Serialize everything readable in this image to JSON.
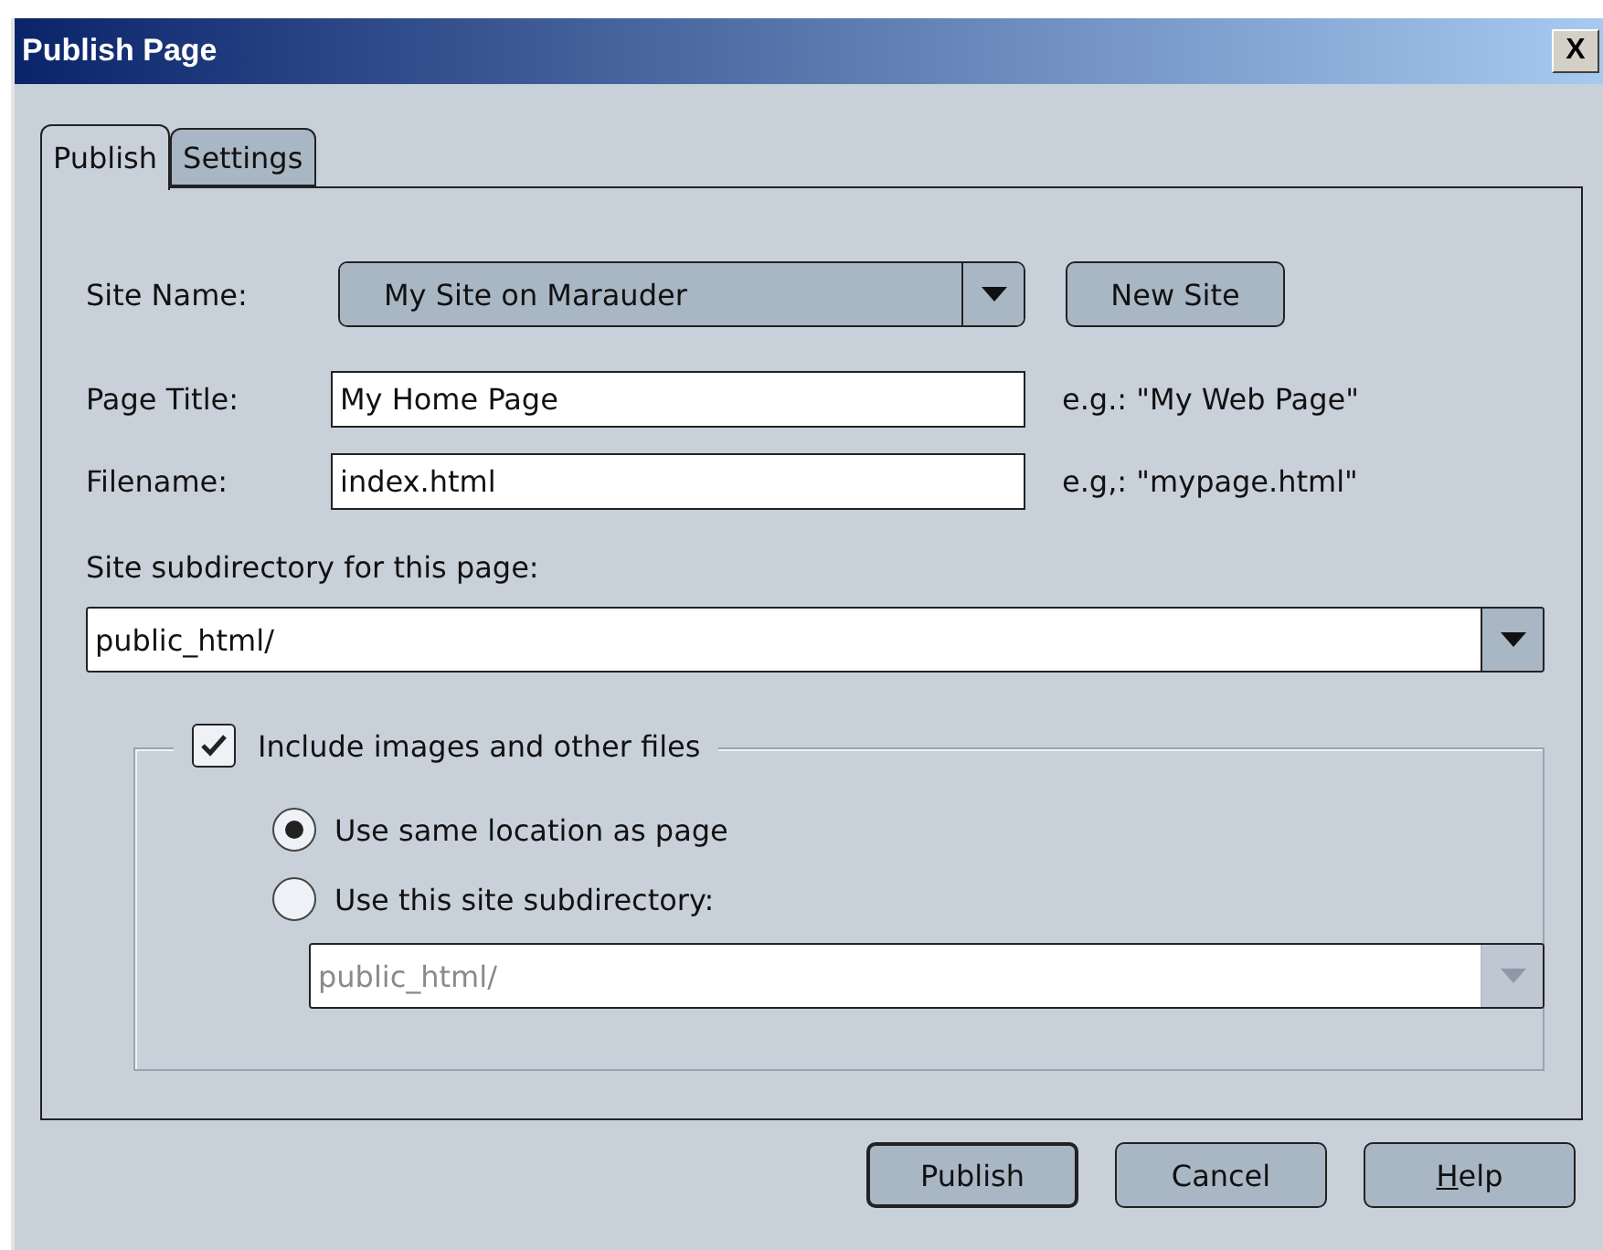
{
  "window": {
    "title": "Publish Page",
    "close_label": "X"
  },
  "tabs": [
    {
      "label": "Publish",
      "selected": true
    },
    {
      "label": "Settings",
      "selected": false
    }
  ],
  "site_name": {
    "label": "Site Name:",
    "value": "My Site on Marauder",
    "button": "New Site"
  },
  "page_title": {
    "label": "Page Title:",
    "value": "My Home Page",
    "hint": "e.g.: \"My Web Page\""
  },
  "filename": {
    "label": "Filename:",
    "value": "index.html",
    "hint": "e.g,: \"mypage.html\""
  },
  "subdirectory": {
    "label": "Site subdirectory for this page:",
    "value": "public_html/"
  },
  "include_files": {
    "label": "Include images and other files",
    "checked": true,
    "options": [
      {
        "label": "Use same location as page",
        "selected": true
      },
      {
        "label": "Use this site subdirectory:",
        "selected": false
      }
    ],
    "subdirectory": {
      "value": "public_html/",
      "disabled": true
    }
  },
  "buttons": [
    {
      "label": "Publish",
      "default": true,
      "underline_first": false
    },
    {
      "label": "Cancel",
      "default": false,
      "underline_first": false
    },
    {
      "label": "Help",
      "default": false,
      "underline_first": true
    }
  ]
}
